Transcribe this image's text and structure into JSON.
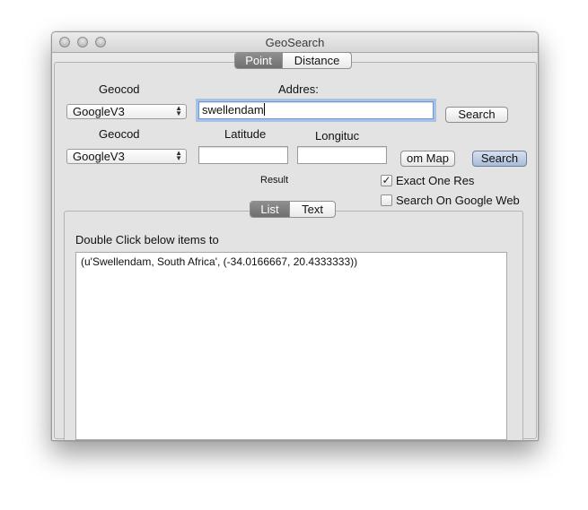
{
  "window": {
    "title": "GeoSearch"
  },
  "mode_tabs": {
    "items": [
      "Point",
      "Distance"
    ],
    "selected": "Point"
  },
  "address_search": {
    "geocoder_label": "Geocod",
    "geocoder_value": "GoogleV3",
    "address_label": "Addres:",
    "address_value": "swellendam",
    "search_label": "Search"
  },
  "coordinate_search": {
    "geocoder_label": "Geocod",
    "geocoder_value": "GoogleV3",
    "latitude_label": "Latitude",
    "latitude_value": "",
    "longitude_label": "Longituc",
    "longitude_value": "",
    "from_map_label": "om Map",
    "search_label": "Search"
  },
  "result_label": "Result",
  "options": {
    "exact_one_result": {
      "label": "Exact One Res",
      "checked": true
    },
    "search_google_web": {
      "label": "Search On Google Web",
      "checked": false
    }
  },
  "result_tabs": {
    "items": [
      "List",
      "Text"
    ],
    "selected": "List"
  },
  "result_panel": {
    "instruction": "Double Click below items to",
    "items": [
      "(u'Swellendam, South Africa', (-34.0166667, 20.4333333))"
    ]
  },
  "colors": {
    "selected_tab": "#7c7c7c",
    "focus_ring": "#78a5e6",
    "default_button": "#a9bcd7"
  }
}
